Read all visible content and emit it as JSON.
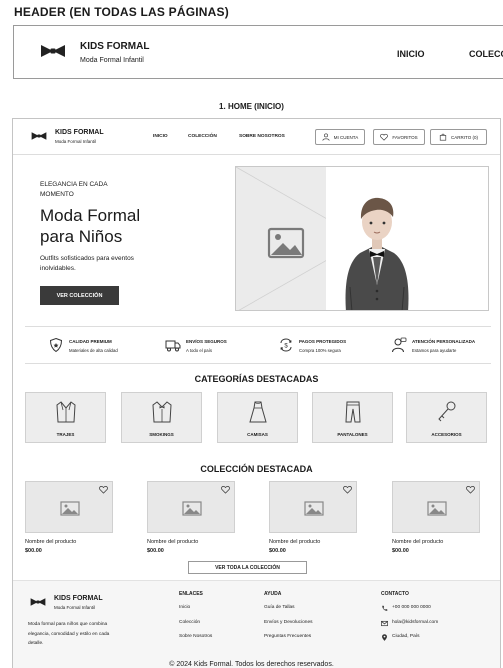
{
  "section_header_title": "HEADER (EN TODAS LAS PÁGINAS)",
  "big_header": {
    "brand": "KIDS FORMAL",
    "subtitle": "Moda Formal Infantil",
    "nav": [
      "INICIO",
      "COLECCIÓN"
    ]
  },
  "home_title": "1. HOME (INICIO)",
  "mock": {
    "header": {
      "brand": "KIDS FORMAL",
      "subtitle": "Moda Formal Infantil",
      "nav": [
        "INICIO",
        "COLECCIÓN",
        "SOBRE NOSOTROS"
      ],
      "buttons": {
        "account": "MI CUENTA",
        "favorites": "FAVORITOS",
        "cart": "CARRITO (0)"
      }
    },
    "hero": {
      "eyebrow": "ELEGANCIA EN CADA MOMENTO",
      "title": "Moda Formal para Niños",
      "description": "Outfits sofisticados para eventos inolvidables.",
      "cta": "VER COLECCIÓN"
    },
    "features": [
      {
        "title": "CALIDAD PREMIUM",
        "subtitle": "Materiales de alta calidad",
        "icon": "shield-icon"
      },
      {
        "title": "ENVÍOS SEGUROS",
        "subtitle": "A todo el país",
        "icon": "truck-icon"
      },
      {
        "title": "PAGOS PROTEGIDOS",
        "subtitle": "Compra 100% segura",
        "icon": "secure-payment-icon"
      },
      {
        "title": "ATENCIÓN PERSONALIZADA",
        "subtitle": "Estamos para ayudarte",
        "icon": "support-icon"
      }
    ],
    "categories_title": "CATEGORÍAS DESTACADAS",
    "categories": [
      {
        "label": "TRAJES",
        "icon": "suit-icon"
      },
      {
        "label": "SMOKINGS",
        "icon": "tuxedo-icon"
      },
      {
        "label": "CAMISAS",
        "icon": "dress-icon"
      },
      {
        "label": "PANTALONES",
        "icon": "pants-icon"
      },
      {
        "label": "ACCESORIOS",
        "icon": "key-icon"
      }
    ],
    "collection_title": "COLECCIÓN DESTACADA",
    "products": [
      {
        "name": "Nombre del producto",
        "price": "$00.00"
      },
      {
        "name": "Nombre del producto",
        "price": "$00.00"
      },
      {
        "name": "Nombre del producto",
        "price": "$00.00"
      },
      {
        "name": "Nombre del producto",
        "price": "$00.00"
      }
    ],
    "see_all": "VER TODA LA COLECCIÓN",
    "footer": {
      "brand": "KIDS FORMAL",
      "subtitle": "Moda Formal Infantil",
      "description": "Moda formal para niños que combina elegancia, comodidad y estilo en cada detalle.",
      "links_title": "ENLACES",
      "links": [
        "Inicio",
        "Colección",
        "Sobre Nosotros"
      ],
      "help_title": "AYUDA",
      "help": [
        "Guía de Tallas",
        "Envíos y Devoluciones",
        "Preguntas Frecuentes"
      ],
      "contact_title": "CONTACTO",
      "contact": {
        "phone": "+00 000 000 0000",
        "email": "hola@kidsformal.com",
        "location": "Ciudad, País"
      }
    }
  },
  "copyright": "© 2024 Kids Formal. Todos los derechos reservados.",
  "colors": {
    "primary": "#3a3a3a",
    "border": "#c4c4c4",
    "placeholder": "#ececec"
  }
}
